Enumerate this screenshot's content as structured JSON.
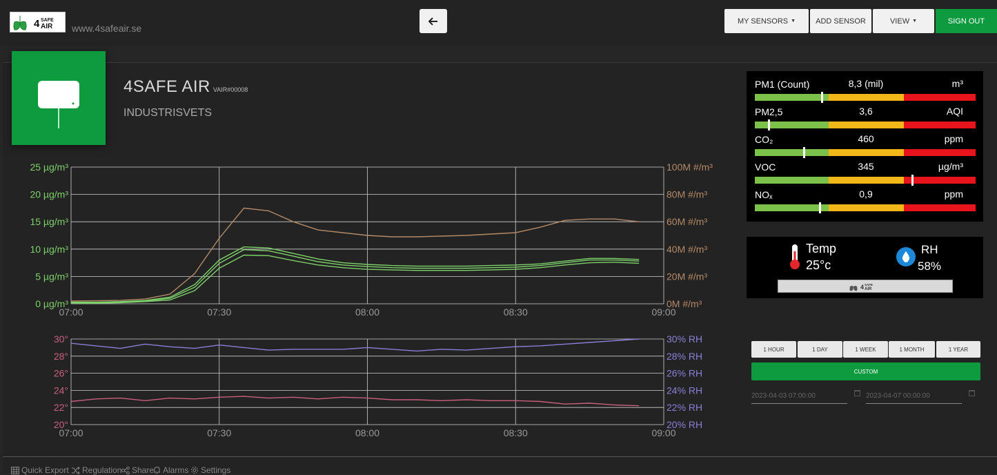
{
  "header": {
    "site": "www.4safeair.se",
    "logo_text": "4SAFE AIR",
    "menu": {
      "my_sensors": "MY SENSORS",
      "add_sensor": "ADD SENSOR",
      "view": "VIEW",
      "sign_out": "SIGN OUT"
    }
  },
  "device": {
    "name": "4SAFE AIR",
    "id": "VAIR#00008",
    "location": "INDUSTRISVETS"
  },
  "sensors": [
    {
      "name": "PM1 (Count)",
      "value": "8,3 (mil)",
      "unit": "m³",
      "level": 0.3
    },
    {
      "name": "PM2,5",
      "value": "3,6",
      "unit": "AQI",
      "level": 0.06
    },
    {
      "name": "CO₂",
      "value": "460",
      "unit": "ppm",
      "level": 0.22
    },
    {
      "name": "VOC",
      "value": "345",
      "unit": "µg/m³",
      "level": 0.71
    },
    {
      "name": "NOₓ",
      "value": "0,9",
      "unit": "ppm",
      "level": 0.29
    }
  ],
  "climate": {
    "temp_label": "Temp",
    "temp_value": "25°c",
    "rh_label": "RH",
    "rh_value": "58%",
    "logo_text": "4SAFE AIR"
  },
  "range": {
    "buttons": [
      "1 HOUR",
      "1 DAY",
      "1 WEEK",
      "1 MONTH",
      "1 YEAR"
    ],
    "custom": "CUSTOM",
    "from": "2023-04-03 07:00:00",
    "to": "2023-04-07 00:00:00"
  },
  "footer": {
    "tabs": [
      "Quick Export",
      "Regulation",
      "Share",
      "Alarms",
      "Settings"
    ]
  },
  "colors": {
    "green": "#0e9a3f",
    "pm_line": "#7ed06a",
    "count_line": "#b58a67",
    "temp_line": "#c9607f",
    "rh_line": "#8a7fd8",
    "bar_good": "#7cc24a",
    "bar_warn": "#f2b81a",
    "bar_bad": "#e8141c"
  },
  "chart_data": [
    {
      "type": "line",
      "x_ticks": [
        "07:00",
        "07:30",
        "08:00",
        "08:30",
        "09:00"
      ],
      "x": [
        "07:00",
        "07:05",
        "07:10",
        "07:15",
        "07:20",
        "07:25",
        "07:30",
        "07:35",
        "07:40",
        "07:45",
        "07:50",
        "07:55",
        "08:00",
        "08:05",
        "08:10",
        "08:15",
        "08:20",
        "08:25",
        "08:30",
        "08:35",
        "08:40",
        "08:45",
        "08:50",
        "08:55"
      ],
      "y_left_ticks": [
        "0 µg/m³",
        "5 µg/m³",
        "10 µg/m³",
        "15 µg/m³",
        "20 µg/m³",
        "25 µg/m³"
      ],
      "y_right_ticks": [
        "0M #/m³",
        "20M #/m³",
        "40M #/m³",
        "60M #/m³",
        "80M #/m³",
        "100M #/m³"
      ],
      "ylim_left": [
        0,
        25
      ],
      "ylim_right": [
        0,
        100
      ],
      "series": [
        {
          "axis": "left",
          "color": "#7ed06a",
          "values": [
            0.3,
            0.3,
            0.4,
            0.6,
            1.2,
            3.5,
            8.0,
            10.4,
            10.2,
            9.2,
            8.2,
            7.5,
            7.2,
            7.0,
            6.9,
            6.9,
            6.9,
            7.0,
            7.1,
            7.3,
            7.8,
            8.3,
            8.3,
            8.1
          ]
        },
        {
          "axis": "left",
          "color": "#7ed06a",
          "values": [
            0.2,
            0.2,
            0.3,
            0.5,
            1.0,
            3.0,
            7.4,
            9.9,
            9.7,
            8.7,
            7.7,
            7.1,
            6.8,
            6.6,
            6.5,
            6.5,
            6.5,
            6.6,
            6.7,
            7.0,
            7.5,
            8.0,
            8.0,
            7.8
          ]
        },
        {
          "axis": "left",
          "color": "#7ed06a",
          "values": [
            0.1,
            0.1,
            0.2,
            0.4,
            0.7,
            2.4,
            6.5,
            8.9,
            8.8,
            7.9,
            7.1,
            6.6,
            6.3,
            6.2,
            6.1,
            6.1,
            6.1,
            6.2,
            6.3,
            6.6,
            7.1,
            7.5,
            7.6,
            7.4
          ]
        },
        {
          "axis": "right",
          "color": "#b58a67",
          "values": [
            2.0,
            2.2,
            2.5,
            3.5,
            7.0,
            22.0,
            48.0,
            70.0,
            68.0,
            60.0,
            54.0,
            52.0,
            50.0,
            49.0,
            49.0,
            49.5,
            50.0,
            51.0,
            52.0,
            56.0,
            61.0,
            62.0,
            62.0,
            60.0
          ]
        }
      ]
    },
    {
      "type": "line",
      "x_ticks": [
        "07:00",
        "07:30",
        "08:00",
        "08:30",
        "09:00"
      ],
      "x": [
        "07:00",
        "07:05",
        "07:10",
        "07:15",
        "07:20",
        "07:25",
        "07:30",
        "07:35",
        "07:40",
        "07:45",
        "07:50",
        "07:55",
        "08:00",
        "08:05",
        "08:10",
        "08:15",
        "08:20",
        "08:25",
        "08:30",
        "08:35",
        "08:40",
        "08:45",
        "08:50",
        "08:55"
      ],
      "y_left_ticks": [
        "20°",
        "22°",
        "24°",
        "26°",
        "28°",
        "30°"
      ],
      "y_right_ticks": [
        "20% RH",
        "22% RH",
        "24% RH",
        "26% RH",
        "28% RH",
        "30% RH"
      ],
      "ylim_left": [
        20,
        30
      ],
      "ylim_right": [
        20,
        30
      ],
      "series": [
        {
          "axis": "left",
          "color": "#c9607f",
          "values": [
            22.7,
            23.0,
            23.1,
            22.8,
            23.1,
            23.0,
            23.2,
            23.3,
            23.1,
            23.2,
            23.0,
            23.2,
            23.1,
            22.9,
            22.9,
            22.8,
            22.9,
            22.8,
            22.8,
            22.7,
            22.4,
            22.5,
            22.3,
            22.2
          ]
        },
        {
          "axis": "right",
          "color": "#8a7fd8",
          "values": [
            29.5,
            29.2,
            28.9,
            29.4,
            29.1,
            28.9,
            29.3,
            29.0,
            28.7,
            28.8,
            28.8,
            28.8,
            29.0,
            28.8,
            28.6,
            28.8,
            28.7,
            28.9,
            29.1,
            29.2,
            29.4,
            29.6,
            29.8,
            30.0
          ]
        }
      ]
    }
  ]
}
